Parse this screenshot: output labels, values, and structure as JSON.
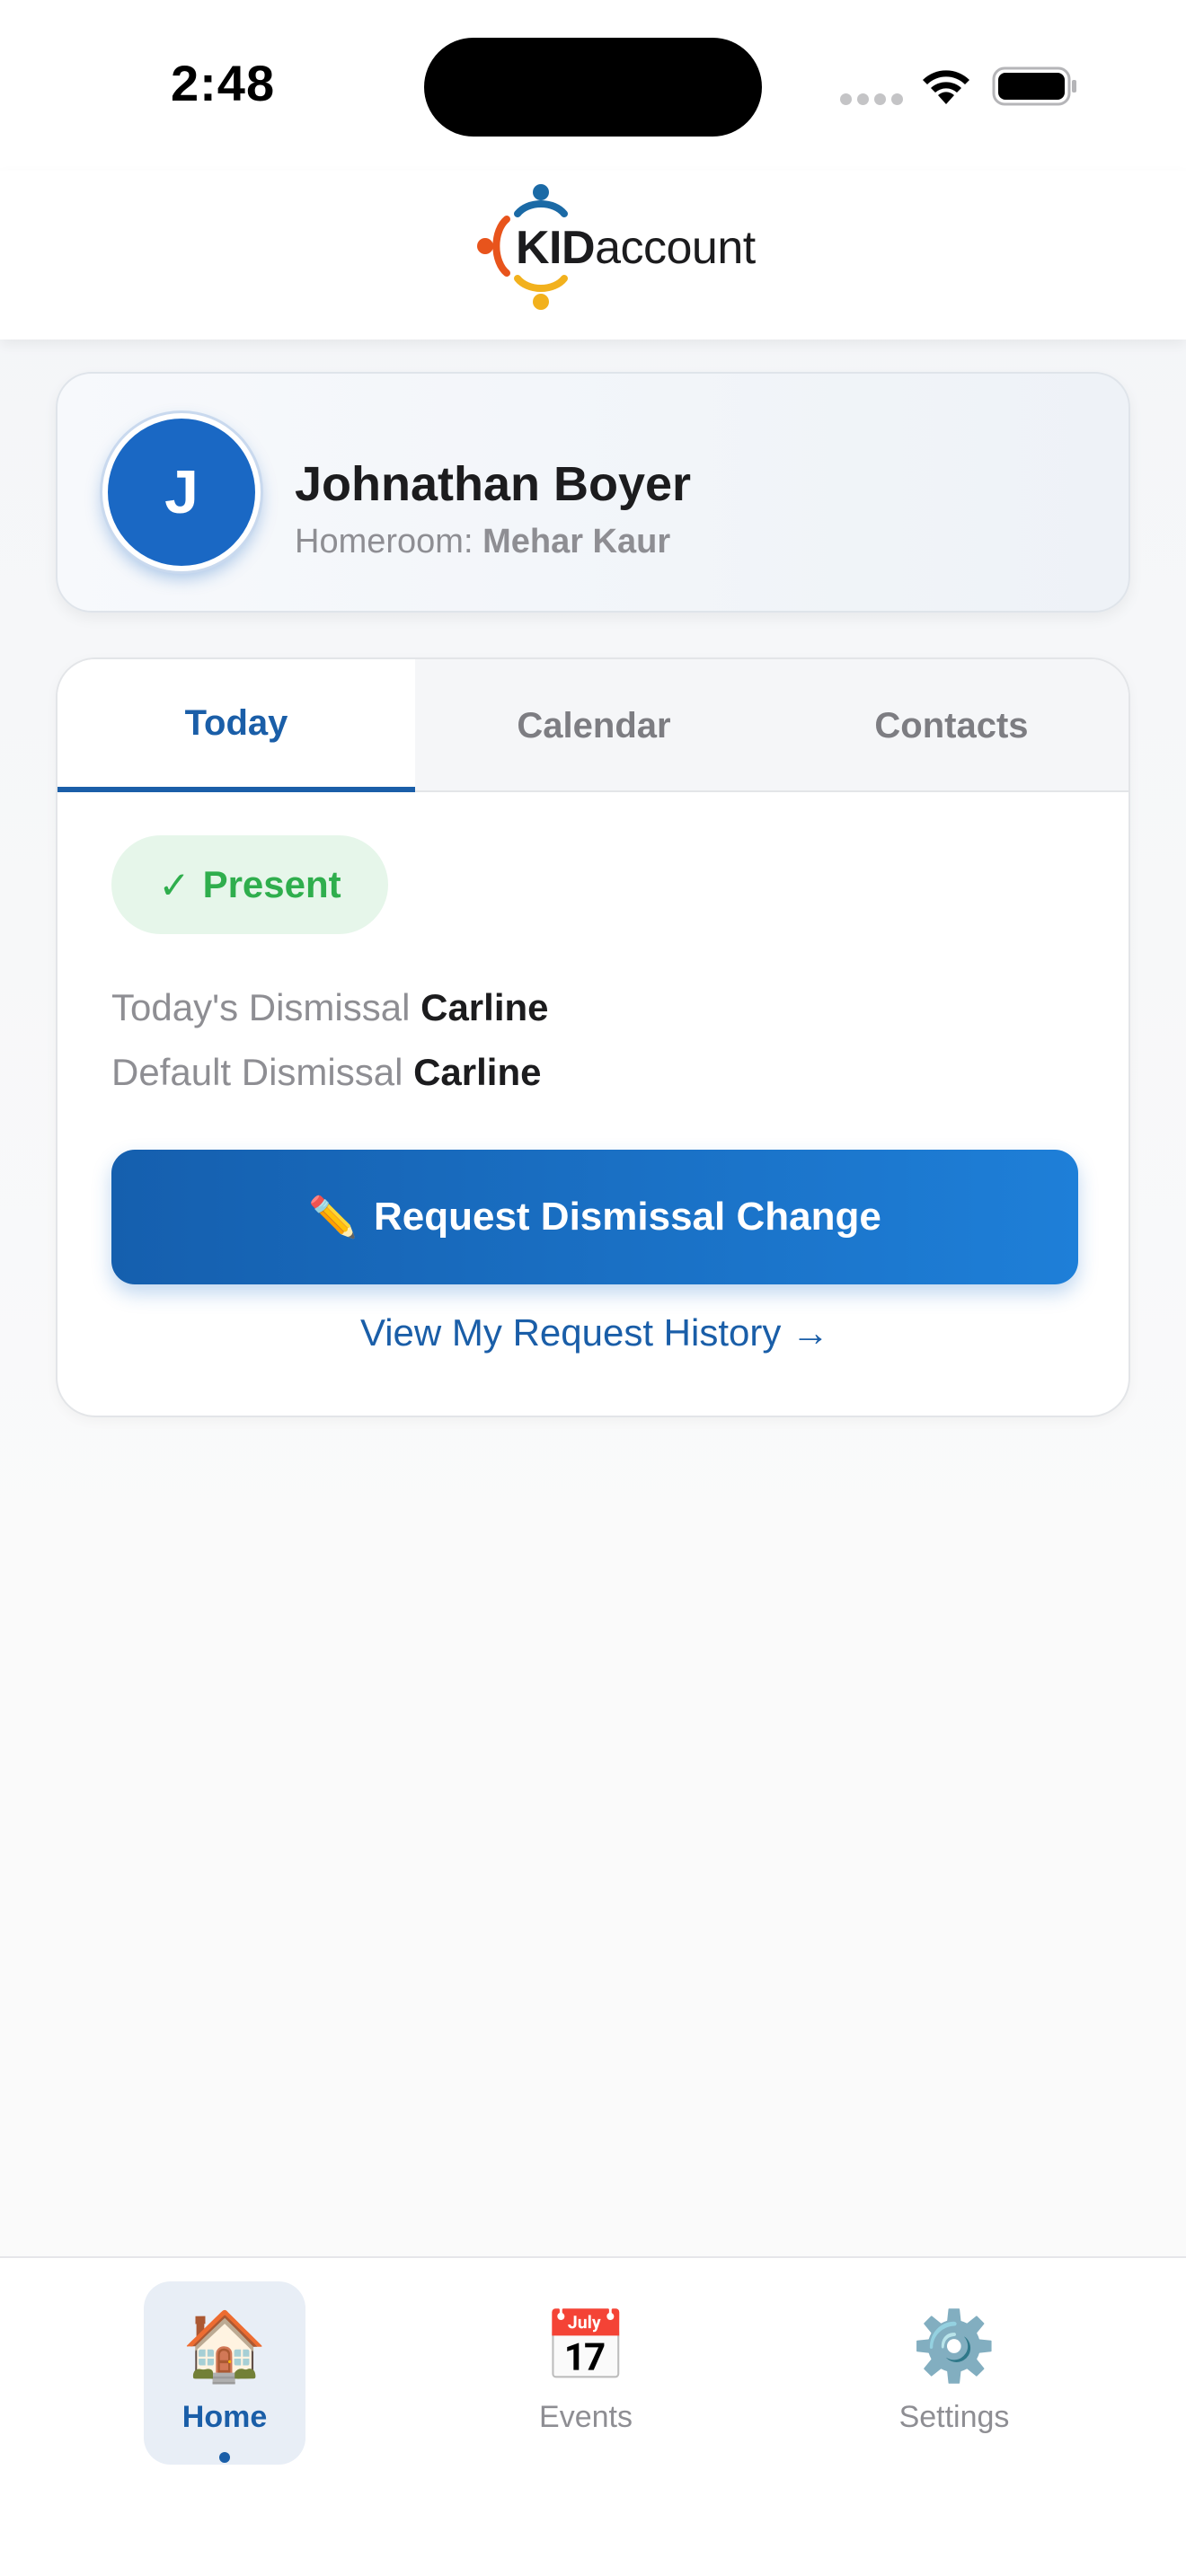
{
  "status_bar": {
    "time": "2:48"
  },
  "header": {
    "logo_kid": "KID",
    "logo_rest": "account"
  },
  "student": {
    "initial": "J",
    "name": "Johnathan Boyer",
    "homeroom_label": "Homeroom:",
    "homeroom_teacher": "Mehar Kaur"
  },
  "tabs": [
    {
      "label": "Today",
      "active": true
    },
    {
      "label": "Calendar",
      "active": false
    },
    {
      "label": "Contacts",
      "active": false
    }
  ],
  "today": {
    "status_check": "✓",
    "status_label": "Present",
    "status_color": "#2fae4d",
    "todays_dismissal_label": "Today's Dismissal",
    "todays_dismissal_value": "Carline",
    "default_dismissal_label": "Default Dismissal",
    "default_dismissal_value": "Carline",
    "request_button_icon": "✏️",
    "request_button_label": "Request Dismissal Change",
    "history_link": "View My Request History →"
  },
  "bottom_nav": [
    {
      "icon": "🏠",
      "icon_name": "home-icon",
      "label": "Home",
      "active": true
    },
    {
      "icon": "📅",
      "icon_name": "calendar-icon",
      "label": "Events",
      "active": false
    },
    {
      "icon": "⚙️",
      "icon_name": "gear-icon",
      "label": "Settings",
      "active": false
    }
  ],
  "colors": {
    "accent": "#1a5ea8",
    "button_start": "#155fae",
    "button_end": "#1e7fd8",
    "present_bg": "#e6f6ea"
  }
}
